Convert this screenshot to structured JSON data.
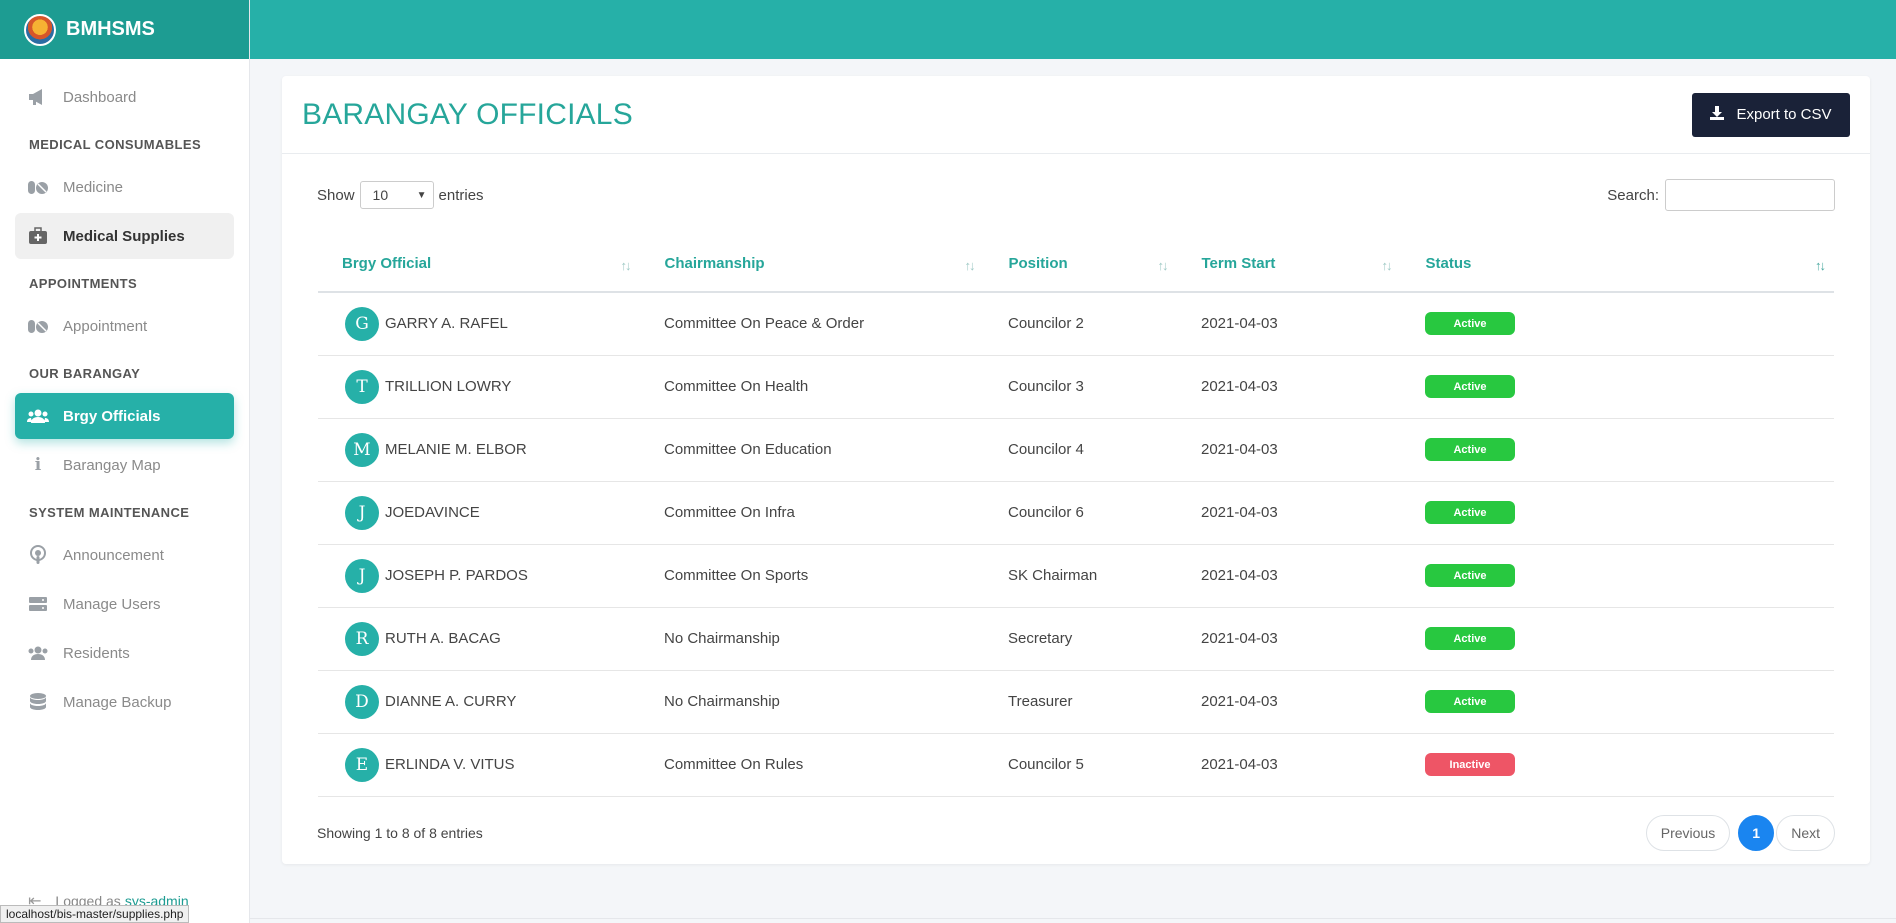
{
  "brand": {
    "name": "BMHSMS",
    "logo_icon": "barangay-seal-icon"
  },
  "sidebar": {
    "dashboard": "Dashboard",
    "sections": [
      {
        "header": "MEDICAL CONSUMABLES",
        "items": [
          "Medicine",
          "Medical Supplies"
        ]
      },
      {
        "header": "APPOINTMENTS",
        "items": [
          "Appointment"
        ]
      },
      {
        "header": "OUR BARANGAY",
        "items": [
          "Brgy Officials",
          "Barangay Map"
        ]
      },
      {
        "header": "SYSTEM MAINTENANCE",
        "items": [
          "Announcement",
          "Manage Users",
          "Residents",
          "Manage Backup"
        ]
      }
    ],
    "logged_prefix": "Logged as",
    "logged_user": "sys-admin"
  },
  "status_url": "localhost/bis-master/supplies.php",
  "page": {
    "title": "BARANGAY OFFICIALS",
    "export_label": "Export to CSV",
    "show_label": "Show",
    "entries_value": "10",
    "entries_label": "entries",
    "search_label": "Search:",
    "search_value": ""
  },
  "table": {
    "columns": [
      "Brgy Official",
      "Chairmanship",
      "Position",
      "Term Start",
      "Status"
    ],
    "rows": [
      {
        "initial": "G",
        "name": "GARRY A. RAFEL",
        "chair": "Committee On Peace & Order",
        "position": "Councilor 2",
        "term": "2021-04-03",
        "status": "Active"
      },
      {
        "initial": "T",
        "name": "TRILLION LOWRY",
        "chair": "Committee On Health",
        "position": "Councilor 3",
        "term": "2021-04-03",
        "status": "Active"
      },
      {
        "initial": "M",
        "name": "MELANIE M. ELBOR",
        "chair": "Committee On Education",
        "position": "Councilor 4",
        "term": "2021-04-03",
        "status": "Active"
      },
      {
        "initial": "J",
        "name": "JOEDAVINCE",
        "chair": "Committee On Infra",
        "position": "Councilor 6",
        "term": "2021-04-03",
        "status": "Active"
      },
      {
        "initial": "J",
        "name": "JOSEPH P. PARDOS",
        "chair": "Committee On Sports",
        "position": "SK Chairman",
        "term": "2021-04-03",
        "status": "Active"
      },
      {
        "initial": "R",
        "name": "RUTH A. BACAG",
        "chair": "No Chairmanship",
        "position": "Secretary",
        "term": "2021-04-03",
        "status": "Active"
      },
      {
        "initial": "D",
        "name": "DIANNE A. CURRY",
        "chair": "No Chairmanship",
        "position": "Treasurer",
        "term": "2021-04-03",
        "status": "Active"
      },
      {
        "initial": "E",
        "name": "ERLINDA V. VITUS",
        "chair": "Committee On Rules",
        "position": "Councilor 5",
        "term": "2021-04-03",
        "status": "Inactive"
      }
    ]
  },
  "footer": {
    "info": "Showing 1 to 8 of 8 entries",
    "prev": "Previous",
    "current": "1",
    "next": "Next"
  },
  "colors": {
    "brand": "#26b0a8",
    "active": "#28c840",
    "inactive": "#ee5566",
    "export": "#1a2238"
  }
}
